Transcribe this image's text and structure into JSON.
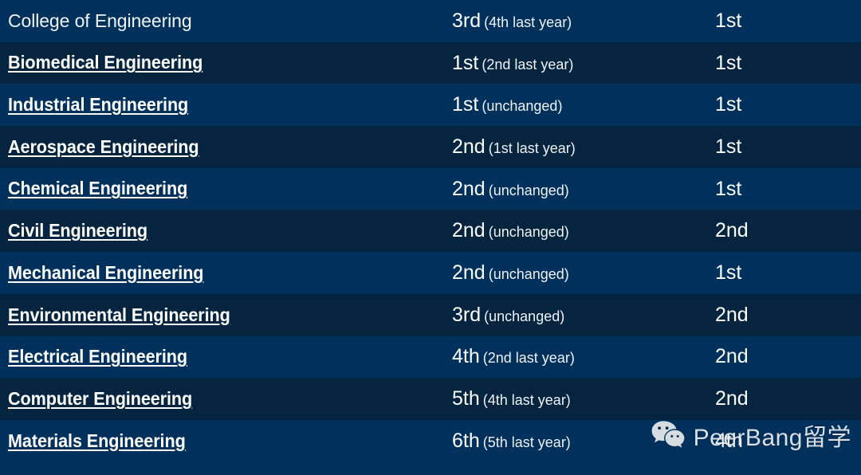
{
  "table": {
    "rows": [
      {
        "program": "College of Engineering",
        "is_link": false,
        "rank": "3rd",
        "rank_note": "(4th last year)",
        "overall": "1st"
      },
      {
        "program": "Biomedical Engineering",
        "is_link": true,
        "rank": "1st",
        "rank_note": "(2nd last year)",
        "overall": "1st"
      },
      {
        "program": "Industrial Engineering",
        "is_link": true,
        "rank": "1st",
        "rank_note": "(unchanged)",
        "overall": "1st"
      },
      {
        "program": "Aerospace Engineering",
        "is_link": true,
        "rank": "2nd",
        "rank_note": "(1st last year)",
        "overall": "1st"
      },
      {
        "program": "Chemical Engineering",
        "is_link": true,
        "rank": "2nd",
        "rank_note": "(unchanged)",
        "overall": "1st"
      },
      {
        "program": "Civil Engineering",
        "is_link": true,
        "rank": "2nd",
        "rank_note": "(unchanged)",
        "overall": "2nd"
      },
      {
        "program": "Mechanical Engineering",
        "is_link": true,
        "rank": "2nd",
        "rank_note": "(unchanged)",
        "overall": "1st"
      },
      {
        "program": "Environmental Engineering",
        "is_link": true,
        "rank": "3rd",
        "rank_note": "(unchanged)",
        "overall": "2nd"
      },
      {
        "program": "Electrical Engineering",
        "is_link": true,
        "rank": "4th",
        "rank_note": "(2nd last year)",
        "overall": "2nd"
      },
      {
        "program": "Computer Engineering",
        "is_link": true,
        "rank": "5th",
        "rank_note": "(4th last year)",
        "overall": "2nd"
      },
      {
        "program": "Materials Engineering",
        "is_link": true,
        "rank": "6th",
        "rank_note": "(5th last year)",
        "overall": "4th"
      }
    ]
  },
  "watermark": {
    "icon": "wechat-icon",
    "label": "PeerBang留学"
  },
  "colors": {
    "row_odd": "#00305c",
    "row_even": "#052440",
    "text": "#ffffff"
  }
}
